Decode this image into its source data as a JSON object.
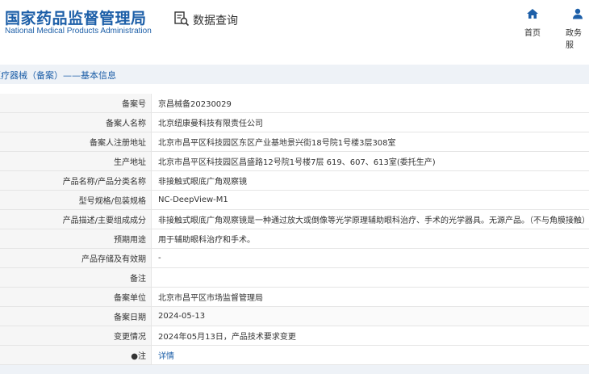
{
  "header": {
    "logo_cn": "国家药品监督管理局",
    "logo_en": "National Medical Products Administration",
    "query_label": "数据查询",
    "nav": [
      {
        "label": "首页",
        "icon": "home-icon"
      },
      {
        "label": "政务服",
        "icon": "user-icon"
      }
    ],
    "brand_color": "#1d5fa8"
  },
  "section_title": "医疗器械（备案）——基本信息",
  "rows": [
    {
      "label": "备案号",
      "value": "京昌械备20230029"
    },
    {
      "label": "备案人名称",
      "value": "北京纽康曼科技有限责任公司"
    },
    {
      "label": "备案人注册地址",
      "value": "北京市昌平区科技园区东区产业基地景兴街18号院1号楼3层308室"
    },
    {
      "label": "生产地址",
      "value": "北京市昌平区科技园区昌盛路12号院1号楼7层 619、607、613室(委托生产)"
    },
    {
      "label": "产品名称/产品分类名称",
      "value": "非接触式眼底广角观察镜"
    },
    {
      "label": "型号规格/包装规格",
      "value": "NC-DeepView-M1"
    },
    {
      "label": "产品描述/主要组成成分",
      "value": "非接触式眼底广角观察镜是一种通过放大或倒像等光学原理辅助眼科治疗、手术的光学器具。无源产品。（不与角膜接触）"
    },
    {
      "label": "预期用途",
      "value": "用于辅助眼科治疗和手术。"
    },
    {
      "label": "产品存储及有效期",
      "value": "-"
    },
    {
      "label": "备注",
      "value": ""
    },
    {
      "label": "备案单位",
      "value": "北京市昌平区市场监督管理局"
    },
    {
      "label": "备案日期",
      "value": "2024-05-13"
    },
    {
      "label": "变更情况",
      "value": "2024年05月13日，产品技术要求变更"
    },
    {
      "label": "●注",
      "value": "详情"
    }
  ]
}
